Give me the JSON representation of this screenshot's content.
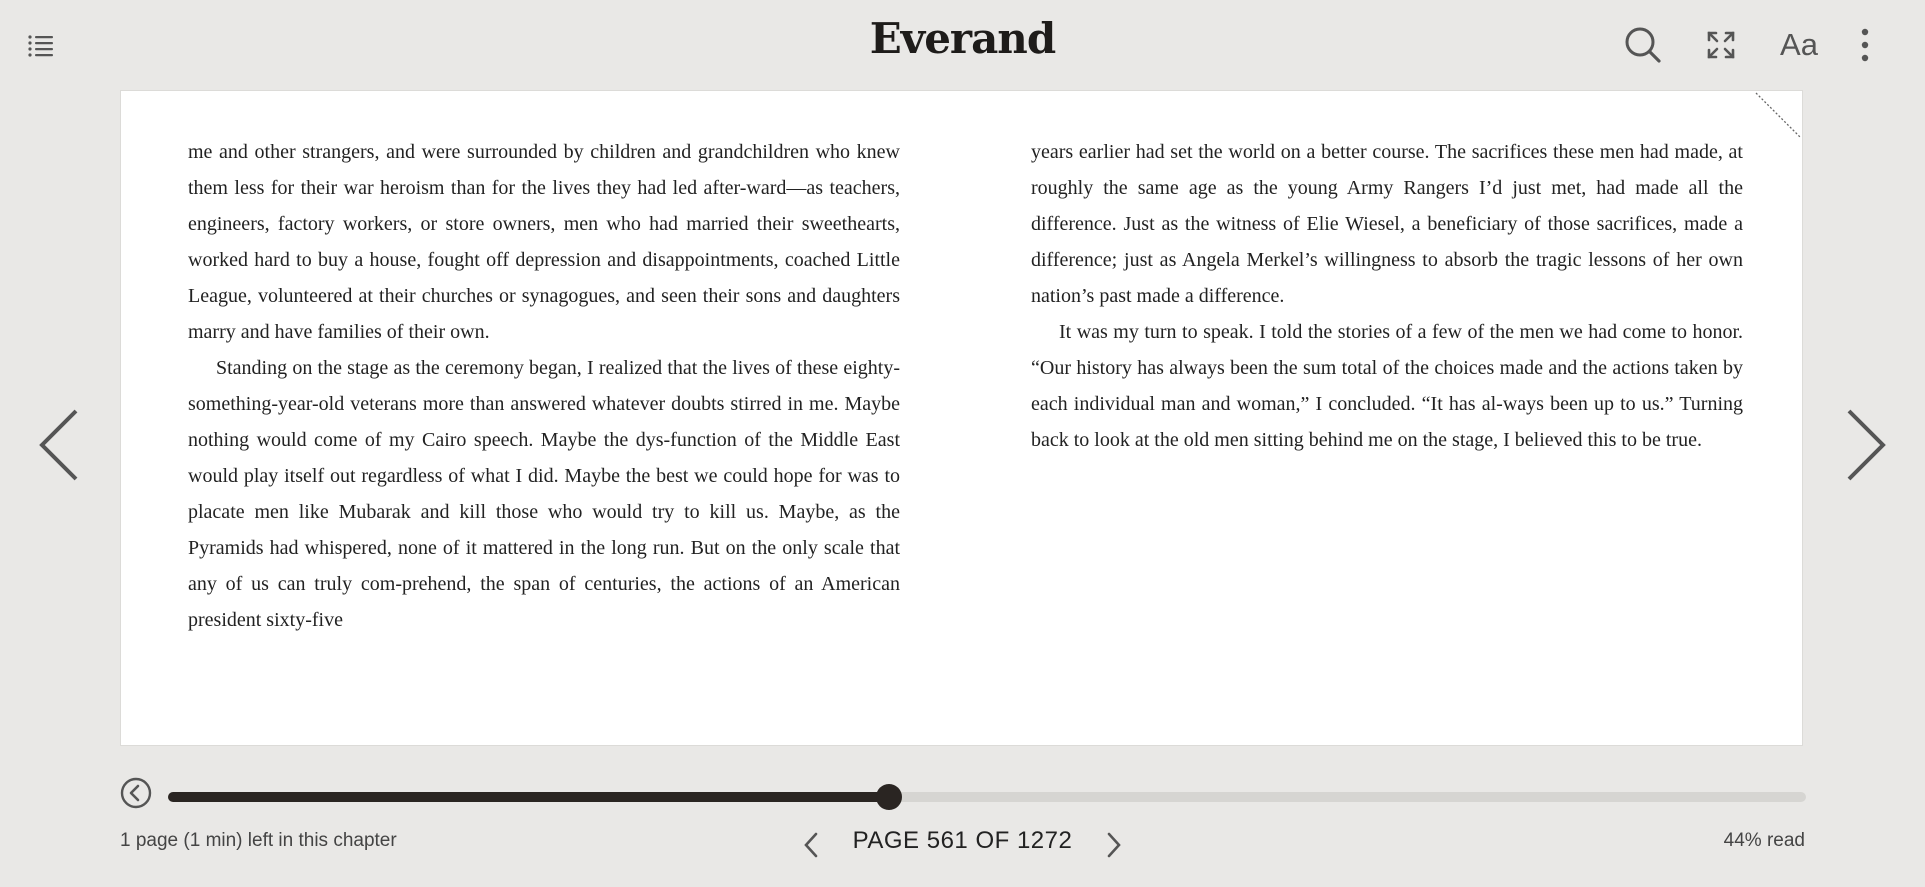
{
  "header": {
    "logo_text": "Everand",
    "menu_icon": "list-icon",
    "icons": [
      "search-icon",
      "fullscreen-icon",
      "font-settings-icon",
      "more-vertical-icon"
    ],
    "font_settings_label": "Aa"
  },
  "reader": {
    "left_column": [
      "me and other strangers, and were surrounded by children and grandchildren who knew them less for their war heroism than for the lives they had led after-ward—as teachers, engineers, factory workers, or store owners, men who had married their sweethearts, worked hard to buy a house, fought off depression and disappointments, coached Little League, volunteered at their churches or synagogues, and seen their sons and daughters marry and have families of their own.",
      "Standing on the stage as the ceremony began, I realized that the lives of these eighty-something-year-old veterans more than answered whatever doubts stirred in me. Maybe nothing would come of my Cairo speech. Maybe the dys-function of the Middle East would play itself out regardless of what I did. Maybe the best we could hope for was to placate men like Mubarak and kill those who would try to kill us. Maybe, as the Pyramids had whispered, none of it mattered in the long run. But on the only scale that any of us can truly com-prehend, the span of centuries, the actions of an American president sixty-five"
    ],
    "right_column": [
      "years earlier had set the world on a better course. The sacrifices these men had made, at roughly the same age as the young Army Rangers I’d just met, had made all the difference. Just as the witness of Elie Wiesel, a beneficiary of those sacrifices, made a difference; just as Angela Merkel’s willingness to absorb the tragic lessons of her own nation’s past made a difference.",
      "It was my turn to speak. I told the stories of a few of the men we had come to honor. “Our history has always been the sum total of the choices made and the actions taken by each individual man and woman,” I concluded. “It has al-ways been up to us.” Turning back to look at the old men sitting behind me on the stage, I believed this to be true."
    ],
    "prev_icon": "chevron-left-icon",
    "next_icon": "chevron-right-icon"
  },
  "footer": {
    "back_icon": "back-circle-icon",
    "progress": 0.44,
    "chapter_remaining": "1 page (1 min) left in this chapter",
    "page_label": "PAGE 561 OF 1272",
    "percent_read": "44% read"
  },
  "colors": {
    "background": "#e9e8e6",
    "page": "#ffffff",
    "accent": "#2a2522",
    "track": "#d6d5d2"
  }
}
